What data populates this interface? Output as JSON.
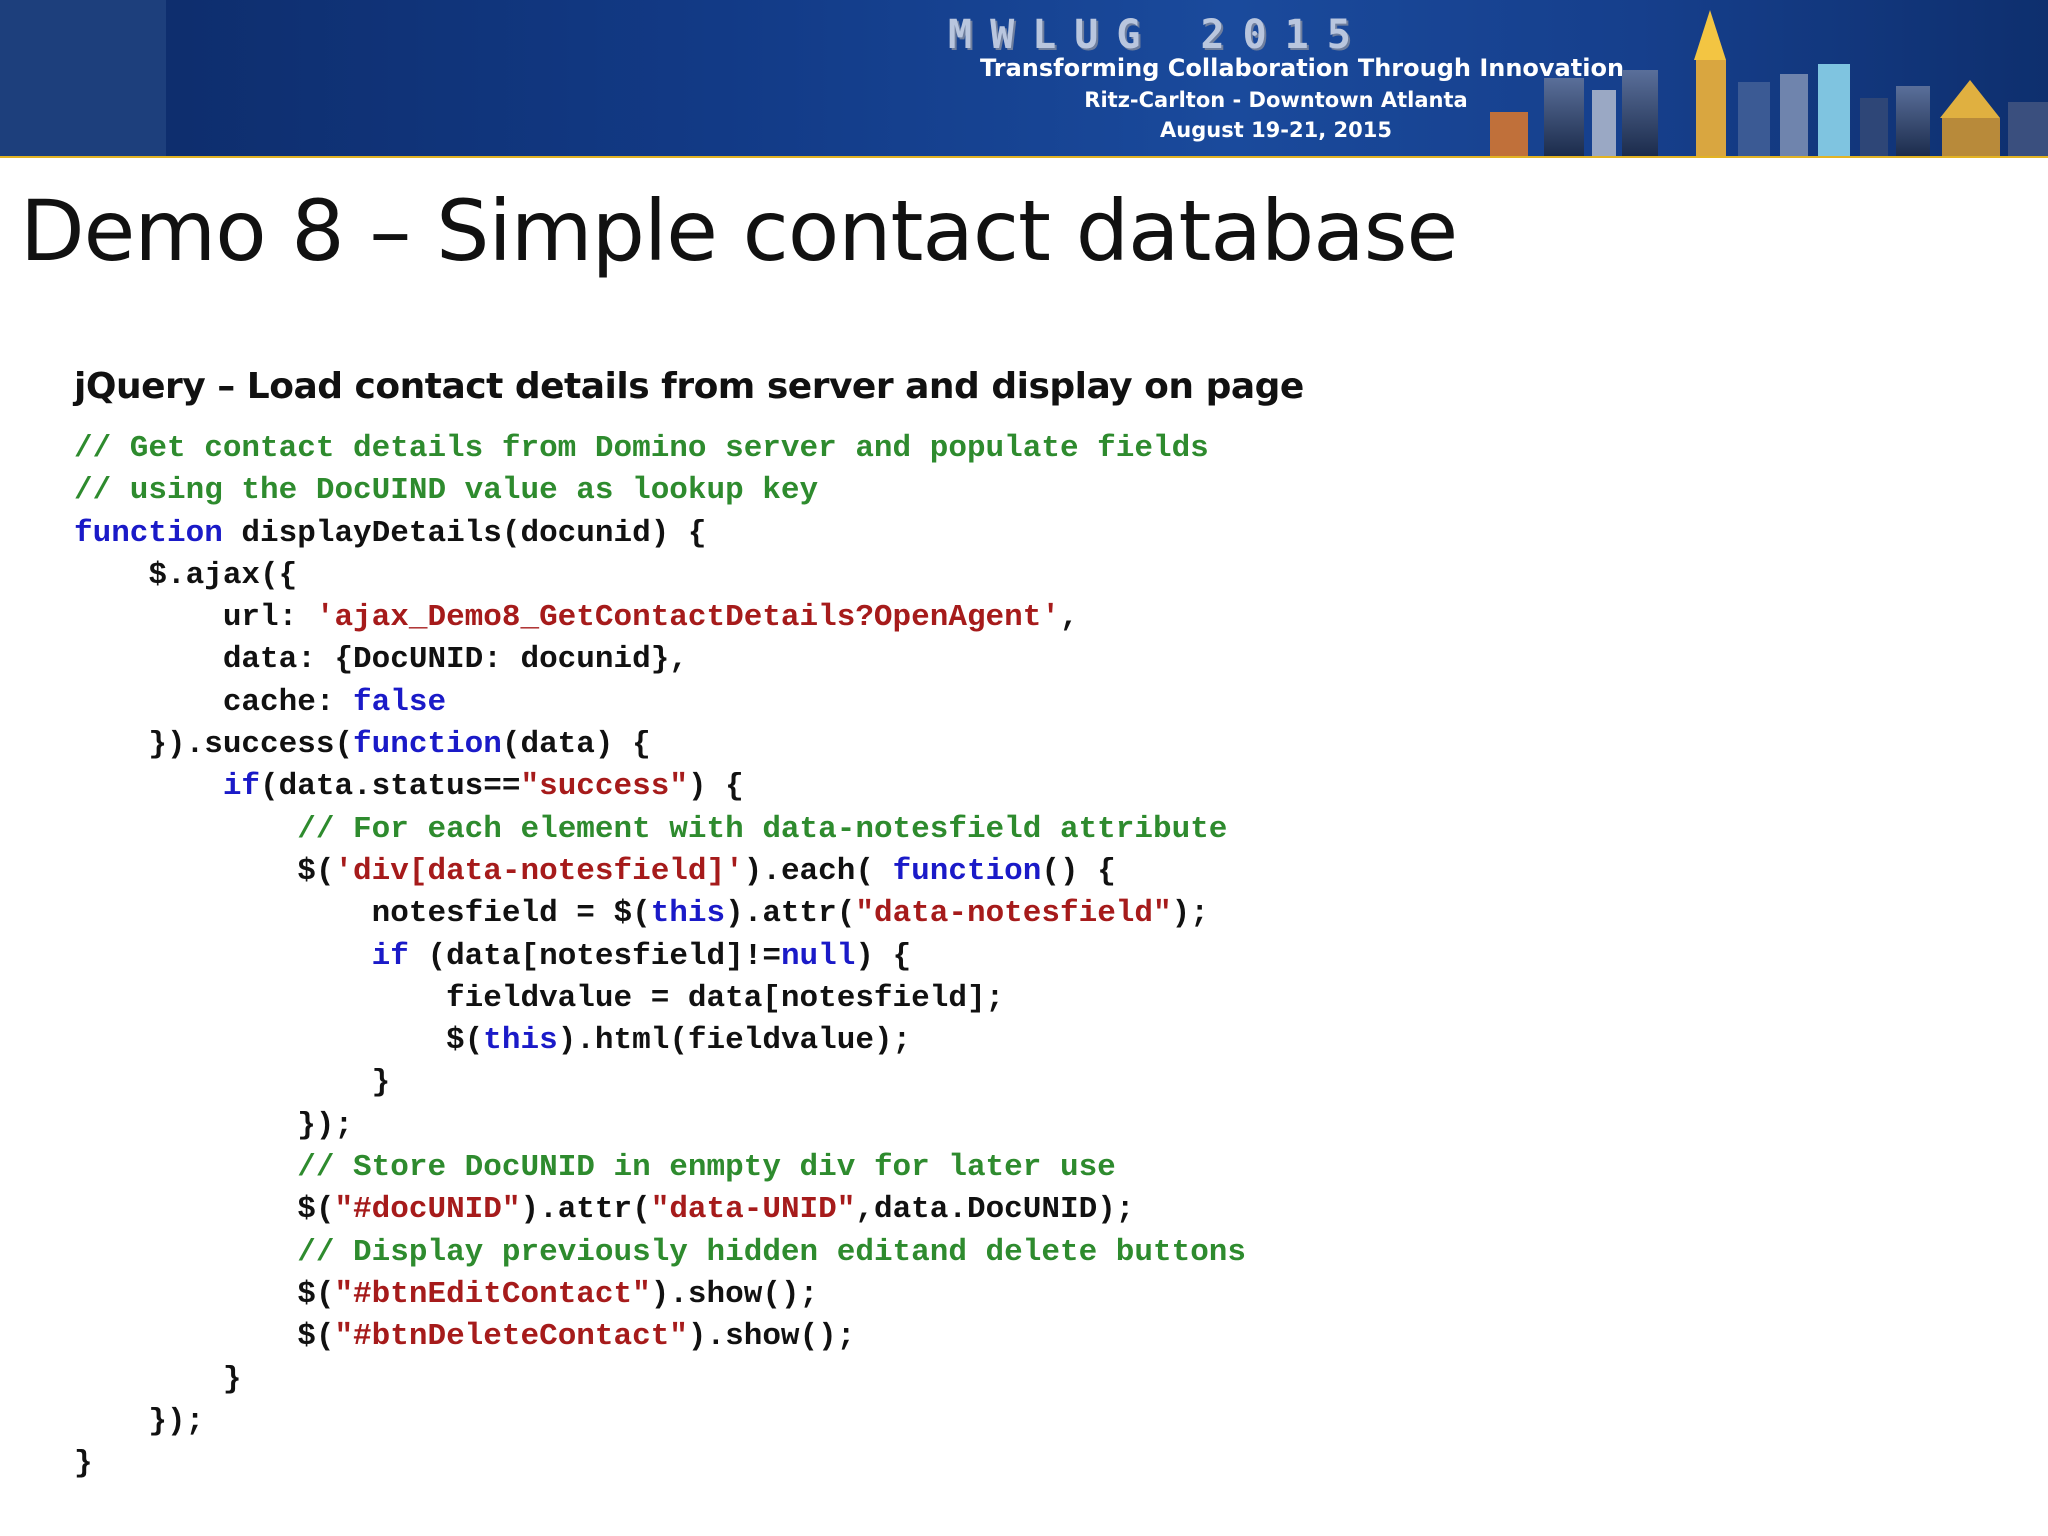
{
  "banner": {
    "event_name": "MWLUG 2015",
    "tagline": "Transforming Collaboration Through Innovation",
    "venue": "Ritz-Carlton - Downtown Atlanta",
    "dates": "August 19-21, 2015",
    "colors": {
      "background": "#123a86",
      "rule": "#e2b323",
      "text": "#ffffff"
    }
  },
  "slide": {
    "title": "Demo 8 – Simple contact database",
    "subtitle": "jQuery – Load contact details from server and display on page"
  },
  "code": {
    "colors": {
      "comment": "#2e8b2e",
      "keyword": "#1a1ac8",
      "string": "#a61b1b",
      "plain": "#111111"
    },
    "lines": [
      [
        {
          "t": "// Get contact details from Domino server and populate fields",
          "c": "cm"
        }
      ],
      [
        {
          "t": "// using the DocUIND value as lookup key",
          "c": "cm"
        }
      ],
      [
        {
          "t": "function",
          "c": "kw"
        },
        {
          "t": " displayDetails(docunid) {",
          "c": "pl"
        }
      ],
      [
        {
          "t": "    $.ajax({",
          "c": "pl"
        }
      ],
      [
        {
          "t": "        url: ",
          "c": "pl"
        },
        {
          "t": "'ajax_Demo8_GetContactDetails?OpenAgent'",
          "c": "st"
        },
        {
          "t": ",",
          "c": "pl"
        }
      ],
      [
        {
          "t": "        data: {DocUNID: docunid},",
          "c": "pl"
        }
      ],
      [
        {
          "t": "        cache: ",
          "c": "pl"
        },
        {
          "t": "false",
          "c": "kw"
        }
      ],
      [
        {
          "t": "    }).success(",
          "c": "pl"
        },
        {
          "t": "function",
          "c": "kw"
        },
        {
          "t": "(data) {",
          "c": "pl"
        }
      ],
      [
        {
          "t": "        ",
          "c": "pl"
        },
        {
          "t": "if",
          "c": "kw"
        },
        {
          "t": "(data.status==",
          "c": "pl"
        },
        {
          "t": "\"success\"",
          "c": "st"
        },
        {
          "t": ") {",
          "c": "pl"
        }
      ],
      [
        {
          "t": "            ",
          "c": "pl"
        },
        {
          "t": "// For each element with data-notesfield attribute",
          "c": "cm"
        }
      ],
      [
        {
          "t": "            $(",
          "c": "pl"
        },
        {
          "t": "'div[data-notesfield]'",
          "c": "st"
        },
        {
          "t": ").each( ",
          "c": "pl"
        },
        {
          "t": "function",
          "c": "kw"
        },
        {
          "t": "() {",
          "c": "pl"
        }
      ],
      [
        {
          "t": "                notesfield = $(",
          "c": "pl"
        },
        {
          "t": "this",
          "c": "kw"
        },
        {
          "t": ").attr(",
          "c": "pl"
        },
        {
          "t": "\"data-notesfield\"",
          "c": "st"
        },
        {
          "t": ");",
          "c": "pl"
        }
      ],
      [
        {
          "t": "                ",
          "c": "pl"
        },
        {
          "t": "if",
          "c": "kw"
        },
        {
          "t": " (data[notesfield]!=",
          "c": "pl"
        },
        {
          "t": "null",
          "c": "kw"
        },
        {
          "t": ") {",
          "c": "pl"
        }
      ],
      [
        {
          "t": "                    fieldvalue = data[notesfield];",
          "c": "pl"
        }
      ],
      [
        {
          "t": "                    $(",
          "c": "pl"
        },
        {
          "t": "this",
          "c": "kw"
        },
        {
          "t": ").html(fieldvalue);",
          "c": "pl"
        }
      ],
      [
        {
          "t": "                }",
          "c": "pl"
        }
      ],
      [
        {
          "t": "            });",
          "c": "pl"
        }
      ],
      [
        {
          "t": "            ",
          "c": "pl"
        },
        {
          "t": "// Store DocUNID in enmpty div for later use",
          "c": "cm"
        }
      ],
      [
        {
          "t": "            $(",
          "c": "pl"
        },
        {
          "t": "\"#docUNID\"",
          "c": "st"
        },
        {
          "t": ").attr(",
          "c": "pl"
        },
        {
          "t": "\"data-UNID\"",
          "c": "st"
        },
        {
          "t": ",data.DocUNID);",
          "c": "pl"
        }
      ],
      [
        {
          "t": "            ",
          "c": "pl"
        },
        {
          "t": "// Display previously hidden editand delete buttons",
          "c": "cm"
        }
      ],
      [
        {
          "t": "            $(",
          "c": "pl"
        },
        {
          "t": "\"#btnEditContact\"",
          "c": "st"
        },
        {
          "t": ").show();",
          "c": "pl"
        }
      ],
      [
        {
          "t": "            $(",
          "c": "pl"
        },
        {
          "t": "\"#btnDeleteContact\"",
          "c": "st"
        },
        {
          "t": ").show();",
          "c": "pl"
        }
      ],
      [
        {
          "t": "        }",
          "c": "pl"
        }
      ],
      [
        {
          "t": "    });",
          "c": "pl"
        }
      ],
      [
        {
          "t": "}",
          "c": "pl"
        }
      ]
    ]
  }
}
